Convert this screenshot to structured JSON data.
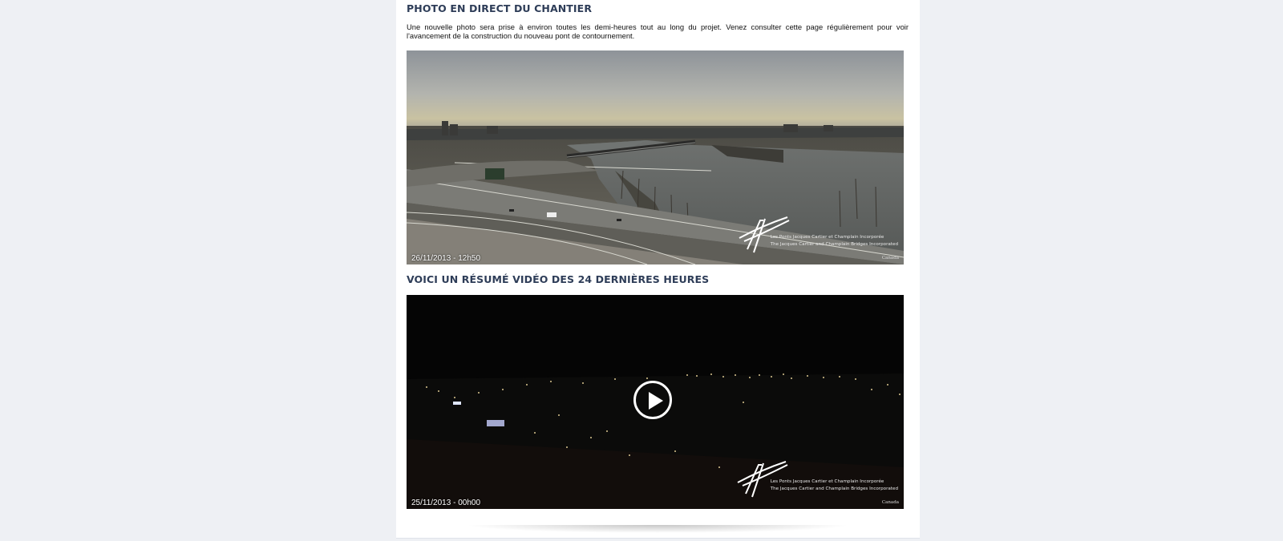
{
  "live_photo": {
    "title": "PHOTO EN DIRECT DU CHANTIER",
    "intro": "Une nouvelle photo sera prise à environ toutes les demi-heures tout au long du projet. Venez consulter cette page régulièrement pour voir l'avancement de la construction du nouveau pont de contournement.",
    "timestamp": "26/11/2013 - 12h50",
    "logo_line1": "Les Ponts Jacques Cartier et Champlain Incorporée",
    "logo_line2": "The Jacques Cartier and Champlain Bridges Incorporated",
    "gov_mark": "Canada"
  },
  "video_summary": {
    "title": "VOICI UN RÉSUMÉ VIDÉO DES 24 DERNIÈRES HEURES",
    "timestamp": "25/11/2013 - 00h00",
    "logo_line1": "Les Ponts Jacques Cartier et Champlain Incorporée",
    "logo_line2": "The Jacques Cartier and Champlain Bridges Incorporated",
    "gov_mark": "Canada",
    "play_icon": "play-icon"
  }
}
